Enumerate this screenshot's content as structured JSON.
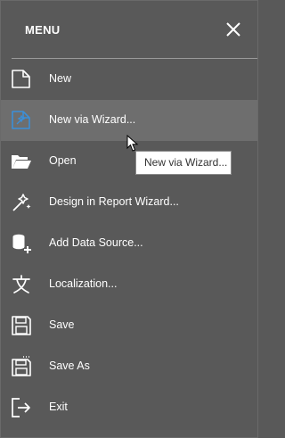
{
  "header": {
    "title": "MENU"
  },
  "menu": {
    "items": [
      {
        "label": "New",
        "icon": "new-document-icon"
      },
      {
        "label": "New via Wizard...",
        "icon": "wizard-icon"
      },
      {
        "label": "Open",
        "icon": "folder-open-icon"
      },
      {
        "label": "Design in Report Wizard...",
        "icon": "magic-wand-icon"
      },
      {
        "label": "Add Data Source...",
        "icon": "add-data-source-icon"
      },
      {
        "label": "Localization...",
        "icon": "localization-icon"
      },
      {
        "label": "Save",
        "icon": "save-icon"
      },
      {
        "label": "Save As",
        "icon": "save-as-icon"
      },
      {
        "label": "Exit",
        "icon": "exit-icon"
      }
    ]
  },
  "tooltip": {
    "text": "New via Wizard..."
  },
  "colors": {
    "panel_bg": "#595959",
    "hover_bg": "#6e6e6e",
    "accent": "#3b8fd8"
  }
}
